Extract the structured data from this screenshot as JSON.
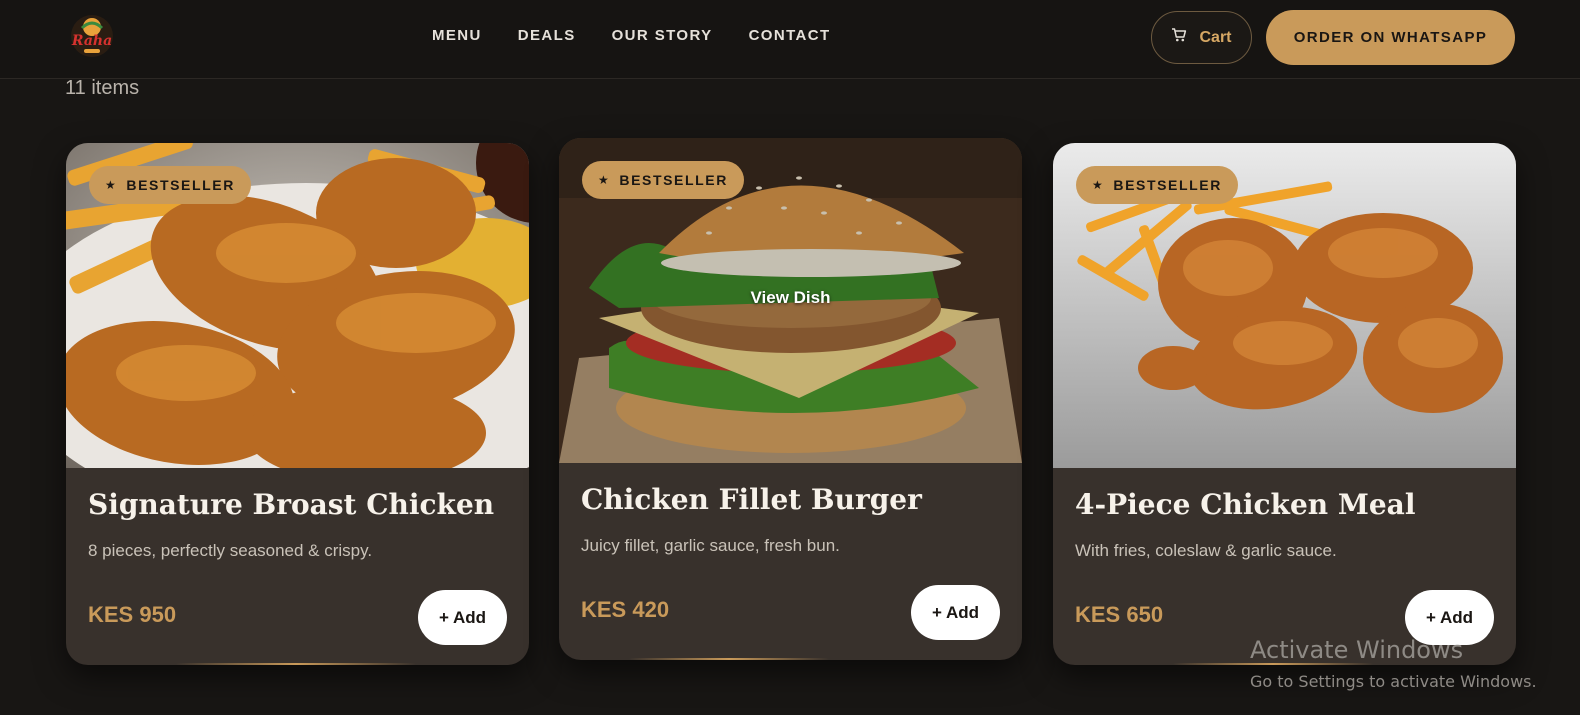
{
  "nav": {
    "items": [
      "MENU",
      "DEALS",
      "OUR STORY",
      "CONTACT"
    ]
  },
  "header": {
    "cart_label": "Cart",
    "whatsapp_label": "ORDER ON WHATSAPP",
    "cart_icon": "cart-icon",
    "logo_icon": "raha-logo"
  },
  "list": {
    "count_text": "11 items"
  },
  "cards": [
    {
      "badge": "BESTSELLER",
      "title": "Signature Broast Chicken",
      "description": "8 pieces, perfectly seasoned & crispy.",
      "price": "KES 950",
      "add_label": "+ Add"
    },
    {
      "badge": "BESTSELLER",
      "title": "Chicken Fillet Burger",
      "description": "Juicy fillet, garlic sauce, fresh bun.",
      "price": "KES 420",
      "add_label": "+ Add",
      "overlay": "View Dish"
    },
    {
      "badge": "BESTSELLER",
      "title": "4-Piece Chicken Meal",
      "description": "With fries, coleslaw & garlic sauce.",
      "price": "KES 650",
      "add_label": "+ Add"
    }
  ],
  "watermark": {
    "line1": "Activate Windows",
    "line2": "Go to Settings to activate Windows."
  },
  "colors": {
    "accent": "#c99a5a",
    "background": "#181614",
    "card": "#38312c"
  }
}
